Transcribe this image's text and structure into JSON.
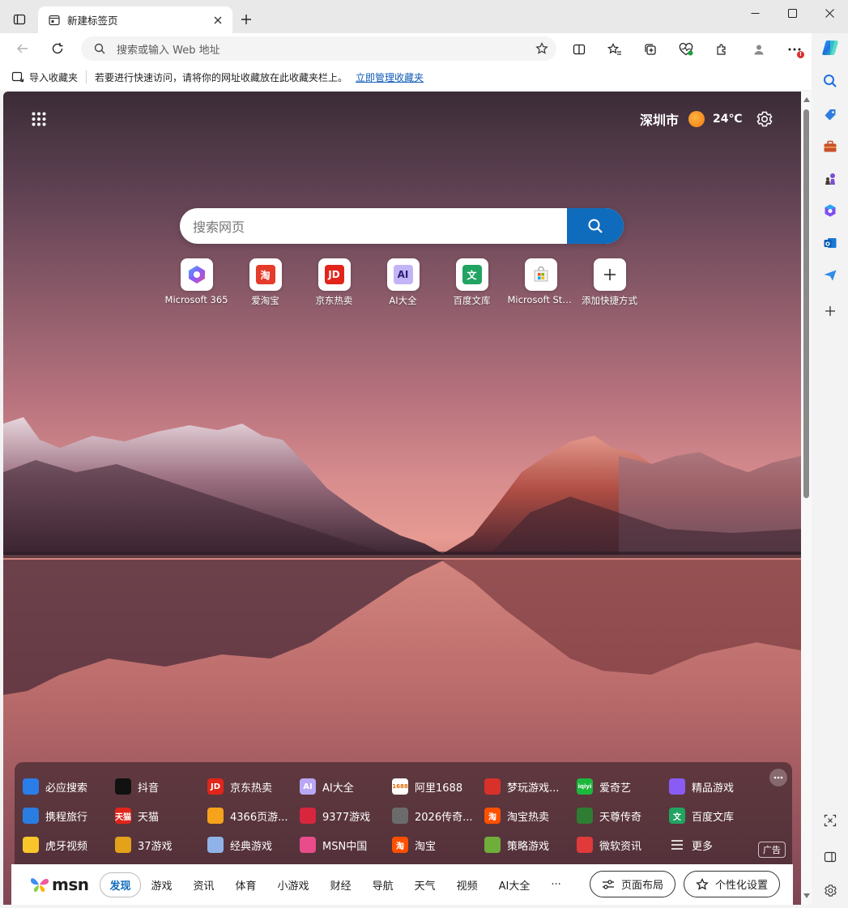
{
  "tab": {
    "title": "新建标签页"
  },
  "address_bar": {
    "placeholder": "搜索或输入 Web 地址"
  },
  "bookmarks_bar": {
    "import_label": "导入收藏夹",
    "hint": "若要进行快速访问，请将你的网址收藏放在此收藏夹栏上。",
    "manage_link": "立即管理收藏夹"
  },
  "weather": {
    "city": "深圳市",
    "temperature": "24℃"
  },
  "search": {
    "placeholder": "搜索网页"
  },
  "quick_links": [
    {
      "label": "Microsoft 365"
    },
    {
      "label": "爱淘宝",
      "glyph": "淘"
    },
    {
      "label": "京东热卖",
      "glyph": "JD"
    },
    {
      "label": "AI大全",
      "glyph": "AI"
    },
    {
      "label": "百度文库",
      "glyph": "文"
    },
    {
      "label": "Microsoft Store"
    },
    {
      "label": "添加快捷方式"
    }
  ],
  "links_panel": {
    "items": [
      {
        "label": "必应搜索",
        "color": "#2b7de9"
      },
      {
        "label": "抖音",
        "color": "#111111"
      },
      {
        "label": "京东热卖",
        "color": "#e1251b",
        "glyph": "JD"
      },
      {
        "label": "AI大全",
        "color": "#b9a6f5",
        "glyph": "AI"
      },
      {
        "label": "阿里1688",
        "color": "#ffffff",
        "glyph": "1688"
      },
      {
        "label": "梦玩游戏...",
        "color": "#d8312a"
      },
      {
        "label": "爱奇艺",
        "color": "#1bb83c",
        "glyph": "iqiyi"
      },
      {
        "label": "精品游戏",
        "color": "#8a5cf5"
      },
      {
        "label": "携程旅行",
        "color": "#2a7de1"
      },
      {
        "label": "天猫",
        "color": "#e1251b",
        "glyph": "天猫"
      },
      {
        "label": "4366页游...",
        "color": "#f7a21b"
      },
      {
        "label": "9377游戏",
        "color": "#d7263d"
      },
      {
        "label": "2026传奇...",
        "color": "#6b6b6b"
      },
      {
        "label": "淘宝热卖",
        "color": "#ff5000",
        "glyph": "淘"
      },
      {
        "label": "天尊传奇",
        "color": "#2e7d32"
      },
      {
        "label": "百度文库",
        "color": "#21a461",
        "glyph": "文"
      },
      {
        "label": "虎牙视频",
        "color": "#f8c52b"
      },
      {
        "label": "37游戏",
        "color": "#e3a21a"
      },
      {
        "label": "经典游戏",
        "color": "#8fb3e8"
      },
      {
        "label": "MSN中国",
        "color": "#e84c8a"
      },
      {
        "label": "淘宝",
        "color": "#ff5000",
        "glyph": "淘"
      },
      {
        "label": "策略游戏",
        "color": "#6fae3b"
      },
      {
        "label": "微软资讯",
        "color": "#e03a3a"
      },
      {
        "label": "更多",
        "color": "transparent"
      }
    ],
    "ad_label": "广告"
  },
  "msn_bar": {
    "logo": "msn",
    "nav": [
      "发现",
      "游戏",
      "资讯",
      "体育",
      "小游戏",
      "财经",
      "导航",
      "天气",
      "视频",
      "AI大全",
      "···"
    ],
    "layout_button": "页面布局",
    "personalize_button": "个性化设置"
  }
}
